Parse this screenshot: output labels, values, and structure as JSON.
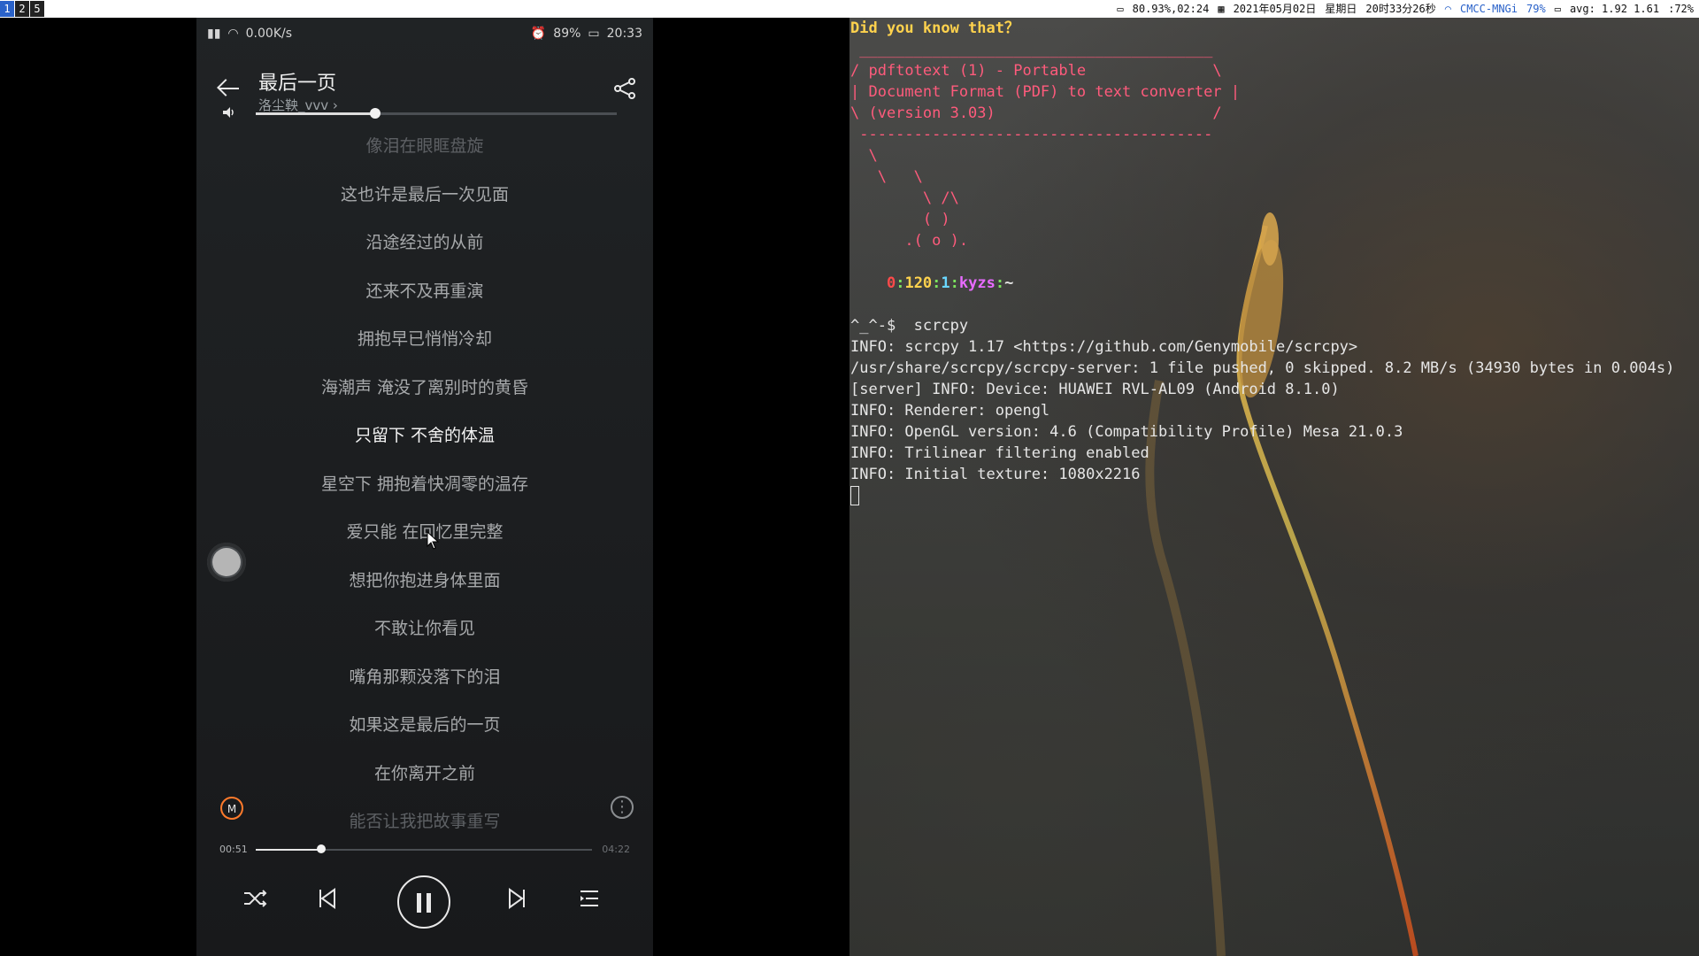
{
  "topbar": {
    "workspaces": [
      "1",
      "2",
      "5"
    ],
    "status": {
      "battery": "80.93%,02:24",
      "date": "2021年05月02日",
      "weekday": "星期日",
      "time": "20时33分26秒",
      "network": "CMCC-MNGi",
      "wifi_strength": "79%",
      "load": "avg: 1.92 1.61",
      "extra": ":72%"
    }
  },
  "phone": {
    "status_bar": {
      "left": "0.00K/s",
      "battery": "89%",
      "time": "20:33"
    },
    "song": {
      "title": "最后一页",
      "artist": "洛尘鞅_vvv"
    },
    "volume_level": 0.33,
    "lyrics": [
      "像泪在眼眶盘旋",
      "这也许是最后一次见面",
      "沿途经过的从前",
      "还来不及再重演",
      "拥抱早已悄悄冷却",
      "海潮声 淹没了离别时的黄昏",
      "只留下 不舍的体温",
      "星空下 拥抱着快凋零的温存",
      "爱只能 在回忆里完整",
      "想把你抱进身体里面",
      "不敢让你看见",
      "嘴角那颗没落下的泪",
      "如果这是最后的一页",
      "在你离开之前",
      "能否让我把故事重写"
    ],
    "active_lyric_index": 6,
    "progress": {
      "current": "00:51",
      "total": "04:22",
      "fraction": 0.195
    },
    "icons": {
      "back": "back-arrow-icon",
      "share": "share-icon",
      "volume": "volume-icon",
      "m_logo": "m-logo-icon",
      "more": "more-icon",
      "shuffle": "shuffle-icon",
      "prev": "previous-icon",
      "pause": "pause-icon",
      "next": "next-icon",
      "playlist": "playlist-icon"
    }
  },
  "terminal": {
    "fortune_heading": "Did you know that？",
    "cowsay": [
      " _______________________________________",
      "/ pdftotext (1) - Portable              \\",
      "| Document Format (PDF) to text converter |",
      "\\ (version 3.03)                        /",
      " ---------------------------------------",
      "  \\",
      "   \\   \\",
      "        \\ /\\",
      "        ( )",
      "      .( o )."
    ],
    "prompt": {
      "a": "0",
      "b": "120",
      "c": "1",
      "user": "kyzs",
      "path": "~"
    },
    "command_prompt": "^_^-$",
    "command": "scrcpy",
    "output": [
      "INFO: scrcpy 1.17 <https://github.com/Genymobile/scrcpy>",
      "/usr/share/scrcpy/scrcpy-server: 1 file pushed, 0 skipped. 8.2 MB/s (34930 bytes in 0.004s)",
      "[server] INFO: Device: HUAWEI RVL-AL09 (Android 8.1.0)",
      "INFO: Renderer: opengl",
      "INFO: OpenGL version: 4.6 (Compatibility Profile) Mesa 21.0.3",
      "INFO: Trilinear filtering enabled",
      "INFO: Initial texture: 1080x2216"
    ]
  },
  "colors": {
    "workspace_active": "#2a62c9",
    "fortune_heading": "#ffd24d",
    "cow": "#ff5b7c",
    "prompt_red": "#ff4a4a",
    "prompt_green": "#7ce35d",
    "prompt_yellow": "#ffd24d",
    "prompt_magenta": "#e86bff",
    "prompt_cyan": "#6ad7ff"
  }
}
